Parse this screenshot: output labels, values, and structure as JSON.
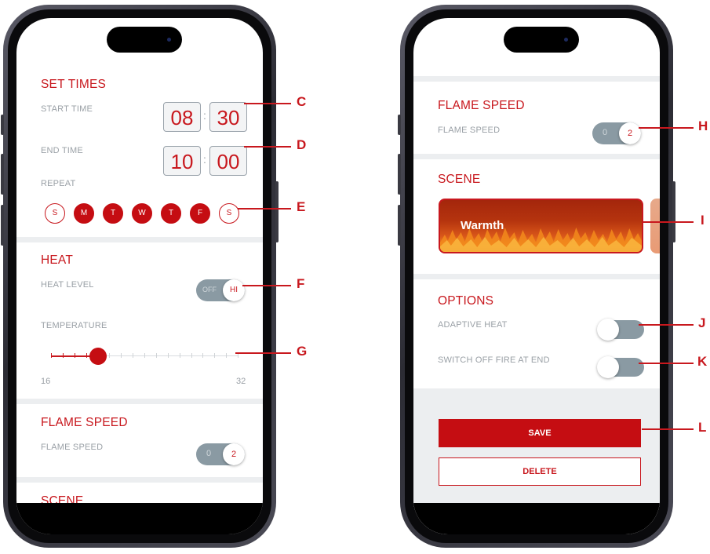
{
  "left_screen": {
    "set_times": {
      "title": "SET TIMES",
      "start_label": "START TIME",
      "start_hour": "08",
      "start_minute": "30",
      "end_label": "END TIME",
      "end_hour": "10",
      "end_minute": "00",
      "colon": ":",
      "repeat_label": "REPEAT",
      "days": [
        {
          "label": "S",
          "selected": false
        },
        {
          "label": "M",
          "selected": true
        },
        {
          "label": "T",
          "selected": true
        },
        {
          "label": "W",
          "selected": true
        },
        {
          "label": "T",
          "selected": true
        },
        {
          "label": "F",
          "selected": true
        },
        {
          "label": "S",
          "selected": false
        }
      ]
    },
    "heat": {
      "title": "HEAT",
      "level_label": "HEAT LEVEL",
      "toggle_off": "OFF",
      "toggle_value": "HI",
      "temperature_label": "TEMPERATURE",
      "temp_min": "16",
      "temp_max": "32",
      "temp_value": 20
    },
    "flame_speed": {
      "title": "FLAME SPEED",
      "label": "FLAME SPEED",
      "off_value": "0",
      "value": "2"
    },
    "scene": {
      "title": "SCENE"
    }
  },
  "right_screen": {
    "flame_speed": {
      "title": "FLAME SPEED",
      "label": "FLAME SPEED",
      "off_value": "0",
      "value": "2"
    },
    "scene": {
      "title": "SCENE",
      "selected_scene": "Warmth"
    },
    "options": {
      "title": "OPTIONS",
      "adaptive_heat_label": "ADAPTIVE HEAT",
      "adaptive_heat_on": false,
      "switch_off_label": "SWITCH OFF FIRE AT END",
      "switch_off_on": false
    },
    "save_label": "SAVE",
    "delete_label": "DELETE"
  },
  "callouts": [
    "C",
    "D",
    "E",
    "F",
    "G",
    "H",
    "I",
    "J",
    "K",
    "L"
  ],
  "colors": {
    "accent": "#c8181e",
    "toggle_grey": "#8a9aa3",
    "section_bg": "#eceef0"
  }
}
